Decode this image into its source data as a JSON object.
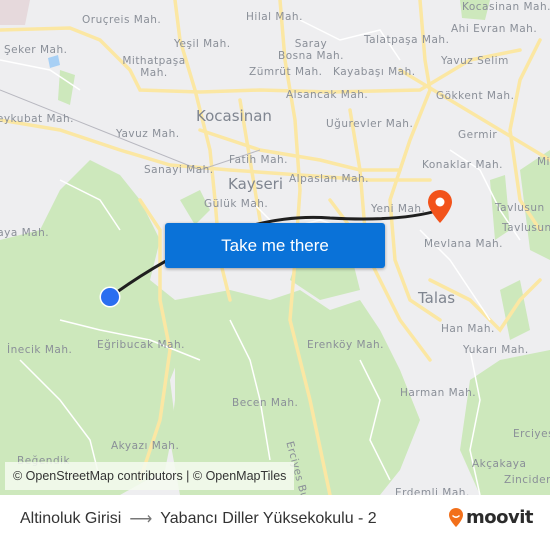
{
  "map": {
    "neighborhood_labels": [
      "Oruçreis Mah.",
      "Hilal Mah.",
      "Kocasinan Mah.",
      "Ahi Evran Mah.",
      "Şeker Mah.",
      "Yeşil Mah.",
      "Saray Bosna Mah.",
      "Talatpaşa Mah.",
      "Mithatpaşa Mah.",
      "Zümrüt Mah.",
      "Kayabaşı Mah.",
      "Yavuz Selim",
      "Alsancak Mah.",
      "Gökkent Mah.",
      "Keykubat Mah.",
      "Yavuz Mah.",
      "Uğurevler Mah.",
      "Germir",
      "Fatih Mah.",
      "Konaklar Mah.",
      "Mi",
      "Sanayi Mah.",
      "Alpaslan Mah.",
      "Gülük Mah.",
      "Yeni Mah.",
      "Tavlusun",
      "Tavlusun",
      "Mevlana Mah.",
      "Kaya Mah.",
      "Han Mah.",
      "İnecik Mah.",
      "Eğribucak Mah.",
      "Erenköy Mah.",
      "Yukarı Mah.",
      "Becen Mah.",
      "Harman Mah.",
      "Erciyes Bulvarı",
      "Erciyes",
      "Akyazı Mah.",
      "Akçakaya",
      "Beğendik",
      "Zincidere",
      "Erdemli Mah."
    ],
    "city_labels": [
      "Kocasinan",
      "Kayseri",
      "Talas"
    ],
    "origin_marker_color": "#2a6ef0",
    "destination_marker_color": "#f2531b",
    "route_line_color": "#1f1f1f"
  },
  "cta": {
    "label": "Take me there",
    "color": "#0a72d8"
  },
  "attribution": "© OpenStreetMap contributors | © OpenMapTiles",
  "footer": {
    "origin": "Altinoluk Girisi",
    "arrow": "⟶",
    "destination": "Yabancı Diller Yüksekokulu - 2",
    "brand": "moovit",
    "brand_color": "#f2701b"
  }
}
